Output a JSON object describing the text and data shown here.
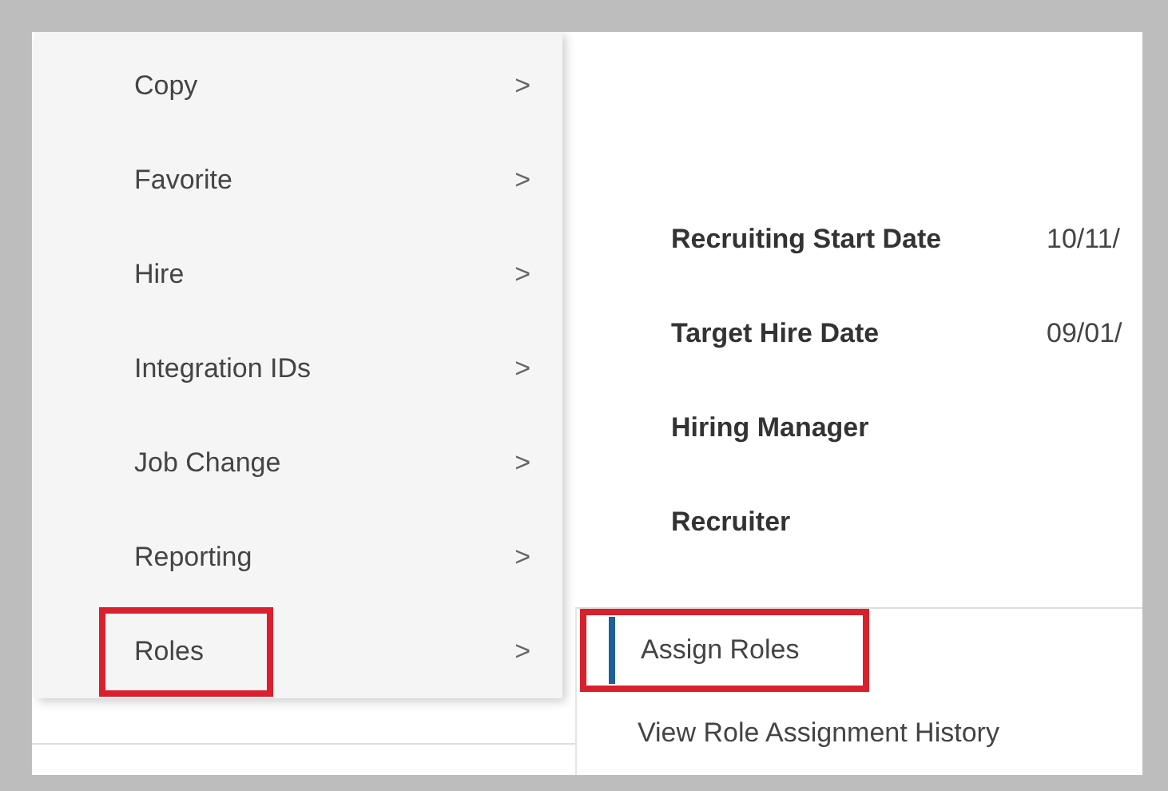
{
  "details": [
    {
      "label": "Recruiting Start Date",
      "value": "10/11/"
    },
    {
      "label": "Target Hire Date",
      "value": "09/01/"
    },
    {
      "label": "Hiring Manager"
    },
    {
      "label": "Recruiter"
    }
  ],
  "menu": {
    "items": [
      {
        "label": "Copy",
        "chevron": ">",
        "highlighted": false
      },
      {
        "label": "Favorite",
        "chevron": ">",
        "highlighted": false
      },
      {
        "label": "Hire",
        "chevron": ">",
        "highlighted": false
      },
      {
        "label": "Integration IDs",
        "chevron": ">",
        "highlighted": false
      },
      {
        "label": "Job Change",
        "chevron": ">",
        "highlighted": false
      },
      {
        "label": "Reporting",
        "chevron": ">",
        "highlighted": false
      },
      {
        "label": "Roles",
        "chevron": ">",
        "highlighted": true
      }
    ]
  },
  "submenu": {
    "items": [
      {
        "label": "Assign Roles",
        "selected": true,
        "highlighted": true
      },
      {
        "label": "View Role Assignment History",
        "selected": false,
        "highlighted": false
      }
    ]
  }
}
